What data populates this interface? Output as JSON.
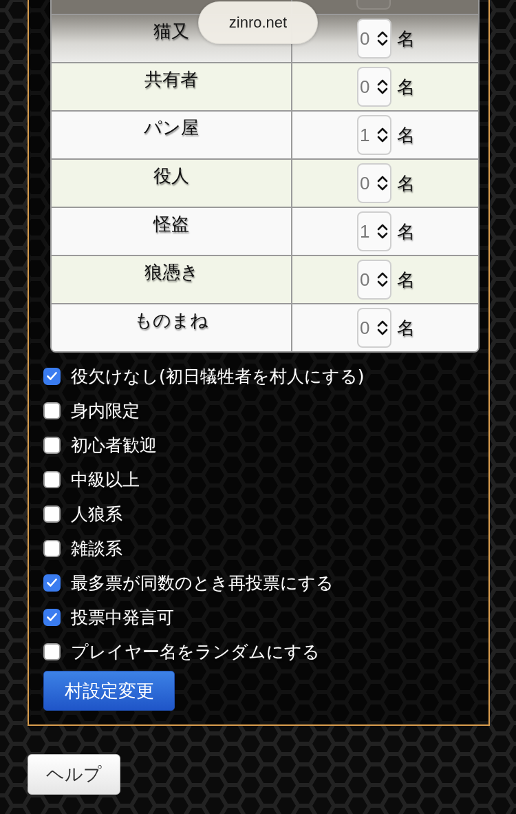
{
  "browser": {
    "url_label": "zinro.net"
  },
  "role_table": {
    "rows": [
      {
        "role": "猫又",
        "count": "0",
        "unit": "名"
      },
      {
        "role": "共有者",
        "count": "0",
        "unit": "名"
      },
      {
        "role": "パン屋",
        "count": "1",
        "unit": "名"
      },
      {
        "role": "役人",
        "count": "0",
        "unit": "名"
      },
      {
        "role": "怪盗",
        "count": "1",
        "unit": "名"
      },
      {
        "role": "狼憑き",
        "count": "0",
        "unit": "名"
      },
      {
        "role": "ものまね",
        "count": "0",
        "unit": "名"
      }
    ]
  },
  "options": [
    {
      "label": "役欠けなし(初日犠牲者を村人にする)",
      "checked": true
    },
    {
      "label": "身内限定",
      "checked": false
    },
    {
      "label": "初心者歓迎",
      "checked": false
    },
    {
      "label": "中級以上",
      "checked": false
    },
    {
      "label": "人狼系",
      "checked": false
    },
    {
      "label": "雑談系",
      "checked": false
    },
    {
      "label": "最多票が同数のとき再投票にする",
      "checked": true
    },
    {
      "label": "投票中発言可",
      "checked": true
    },
    {
      "label": "プレイヤー名をランダムにする",
      "checked": false
    }
  ],
  "buttons": {
    "submit": "村設定変更",
    "help": "ヘルプ"
  }
}
